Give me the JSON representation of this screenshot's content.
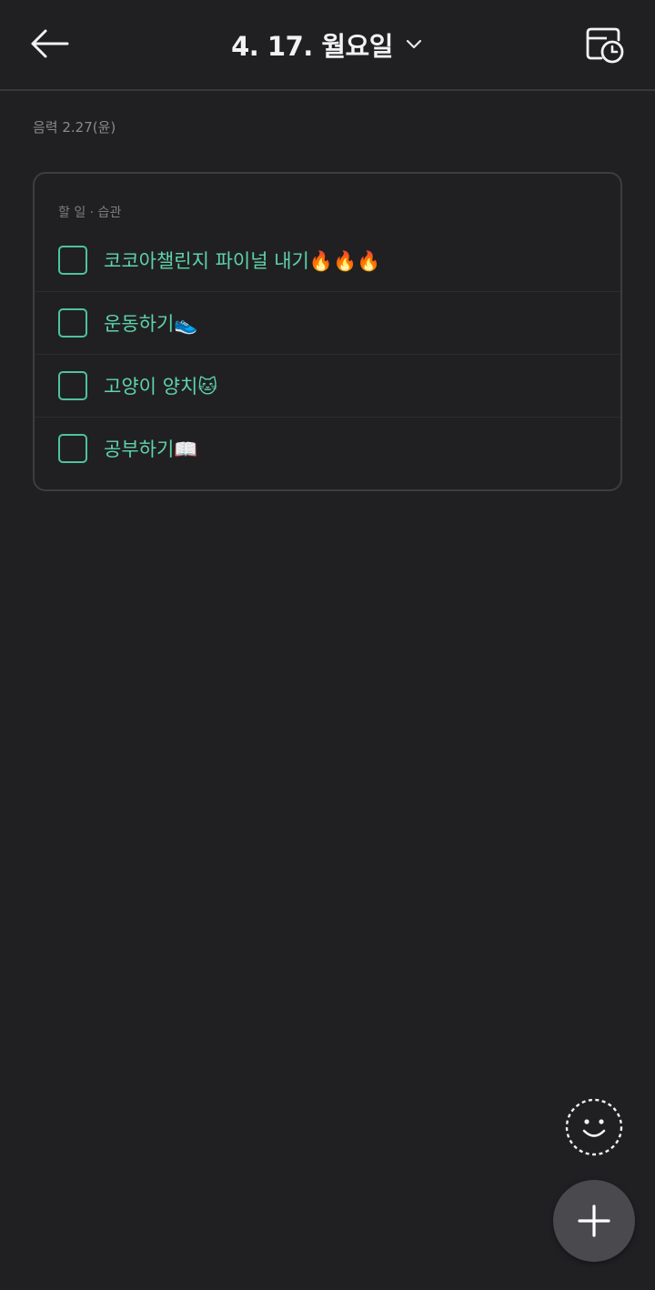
{
  "header": {
    "back_icon": "arrow-left-icon",
    "title": "4. 17. 월요일",
    "dropdown_icon": "chevron-down-icon",
    "history_icon": "calendar-clock-icon"
  },
  "lunar_date": "음력 2.27(윤)",
  "todo_card": {
    "category_label": "할 일 · 습관",
    "items": [
      {
        "text": "코코아챌린지 파이널 내기🔥🔥🔥",
        "checked": false
      },
      {
        "text": "운동하기👟",
        "checked": false
      },
      {
        "text": "고양이 양치🐱",
        "checked": false
      },
      {
        "text": "공부하기📖",
        "checked": false
      }
    ]
  },
  "fab": {
    "emoji_icon": "smiley-dashed-icon",
    "add_icon": "plus-icon"
  },
  "colors": {
    "background": "#202022",
    "accent": "#5fd3a8",
    "card_border": "#3d3d40",
    "fab": "#4a4a4e"
  }
}
